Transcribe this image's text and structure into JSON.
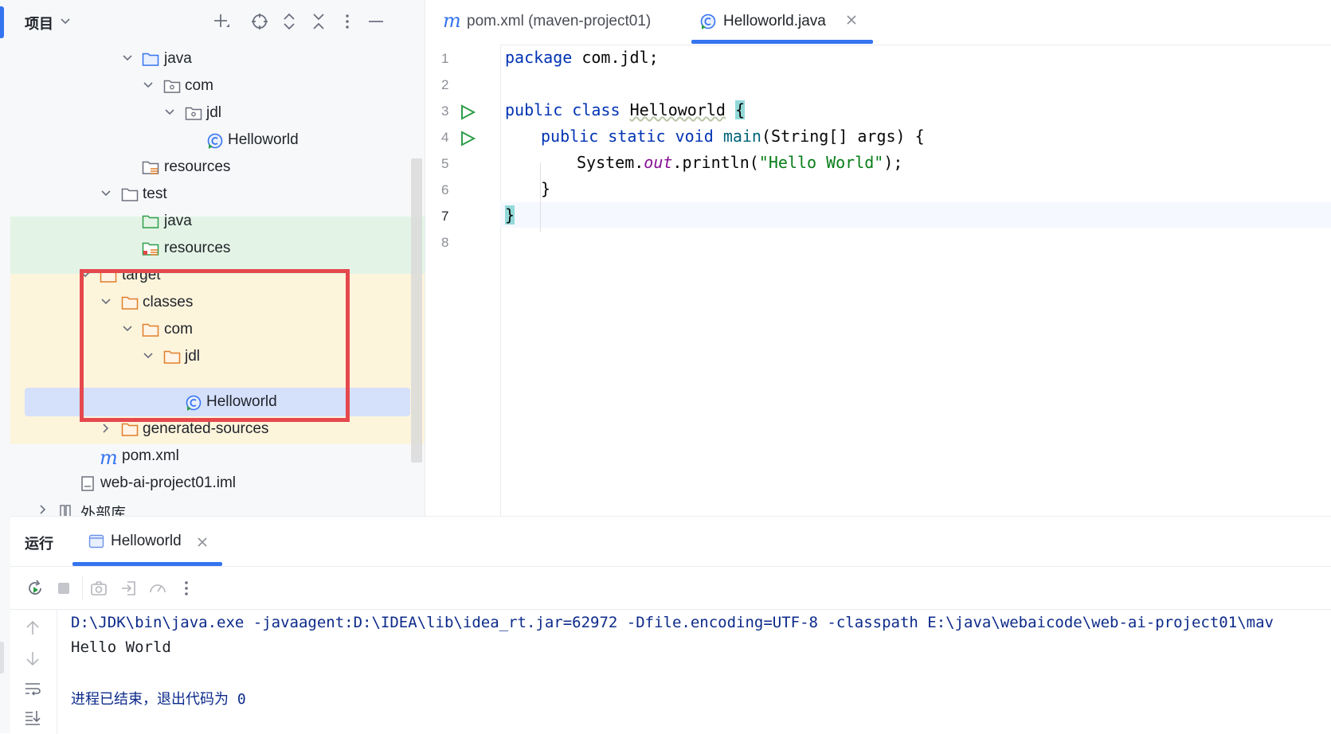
{
  "project_panel": {
    "title": "项目",
    "tree": [
      {
        "label": "java",
        "kind": "source-folder",
        "expanded": true
      },
      {
        "label": "com",
        "kind": "package",
        "expanded": true
      },
      {
        "label": "jdl",
        "kind": "package",
        "expanded": true
      },
      {
        "label": "Helloworld",
        "kind": "java-class"
      },
      {
        "label": "resources",
        "kind": "resources-folder"
      },
      {
        "label": "test",
        "kind": "folder",
        "expanded": true
      },
      {
        "label": "java",
        "kind": "test-source-folder"
      },
      {
        "label": "resources",
        "kind": "test-resources-folder"
      },
      {
        "label": "target",
        "kind": "excluded-folder",
        "expanded": true
      },
      {
        "label": "classes",
        "kind": "excluded-folder",
        "expanded": true
      },
      {
        "label": "com",
        "kind": "excluded-folder",
        "expanded": true
      },
      {
        "label": "jdl",
        "kind": "excluded-folder",
        "expanded": true
      },
      {
        "label": "Helloworld",
        "kind": "class-file",
        "selected": true
      },
      {
        "label": "generated-sources",
        "kind": "excluded-folder",
        "expanded": false
      },
      {
        "label": "pom.xml",
        "kind": "maven-file"
      },
      {
        "label": "web-ai-project01.iml",
        "kind": "iml-file"
      },
      {
        "label": "外部库",
        "kind": "library"
      }
    ]
  },
  "editor": {
    "tabs": [
      {
        "label": "pom.xml (maven-project01)",
        "icon": "maven-icon",
        "active": false
      },
      {
        "label": "Helloworld.java",
        "icon": "java-class-icon",
        "active": true
      }
    ],
    "line_numbers": [
      "1",
      "2",
      "3",
      "4",
      "5",
      "6",
      "7",
      "8"
    ],
    "current_line": "7",
    "code": {
      "l1_kw": "package",
      "l1_rest": " com.jdl;",
      "l3_kw1": "public",
      "l3_kw2": "class",
      "l3_name": "Helloworld",
      "l3_brace": "{",
      "l4_kw1": "public",
      "l4_kw2": "static",
      "l4_kw3": "void",
      "l4_fn": "main",
      "l4_rest": "(String[] args) {",
      "l5_a": "System.",
      "l5_field": "out",
      "l5_b": ".println(",
      "l5_str": "\"Hello World\"",
      "l5_c": ");",
      "l6": "}",
      "l7": "}"
    }
  },
  "run_panel": {
    "title": "运行",
    "tab_label": "Helloworld",
    "console": {
      "command": "D:\\JDK\\bin\\java.exe -javaagent:D:\\IDEA\\lib\\idea_rt.jar=62972 -Dfile.encoding=UTF-8 -classpath E:\\java\\webaicode\\web-ai-project01\\mav",
      "output": "Hello World",
      "exit": "进程已结束，退出代码为 0"
    }
  },
  "colors": {
    "accent": "#3574f0",
    "highlight_box": "#e5484d",
    "test_band": "#e3f4e6",
    "excluded_band": "#fdf4dc",
    "selection": "#d5e0fb",
    "run_green": "#2e9e4a"
  }
}
